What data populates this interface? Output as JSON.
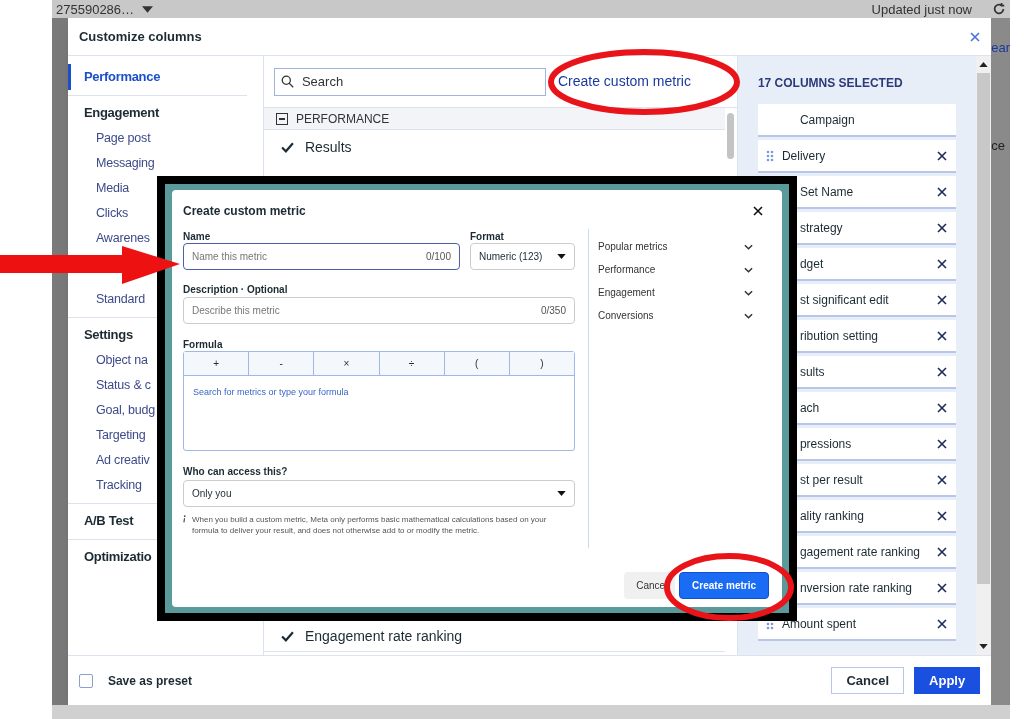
{
  "top_bar": {
    "account": "275590286…",
    "status": "Updated just now",
    "edge_fragments": [
      "ear",
      "ce"
    ]
  },
  "dialog": {
    "title": "Customize columns",
    "nav": [
      {
        "title": "Performance",
        "selected": true
      },
      {
        "title": "Engagement",
        "selected": false,
        "items": [
          {
            "label": "Page post",
            "selected": false
          },
          {
            "label": "Messaging",
            "selected": false
          },
          {
            "label": "Media",
            "selected": false
          },
          {
            "label": "Clicks",
            "selected": false
          },
          {
            "label": "Awarenes",
            "selected": false
          }
        ]
      },
      {
        "items": [
          {
            "label": "Standard",
            "selected": false
          }
        ]
      },
      {
        "title": "Settings",
        "selected": false,
        "items": [
          {
            "label": "Object na",
            "selected": false
          },
          {
            "label": "Status & c",
            "selected": false
          },
          {
            "label": "Goal, budg",
            "selected": false
          },
          {
            "label": "Targeting",
            "selected": false
          },
          {
            "label": "Ad creativ",
            "selected": false
          },
          {
            "label": "Tracking",
            "selected": false
          }
        ]
      },
      {
        "title": "A/B Test",
        "selected": false
      },
      {
        "title": "Optimizatio",
        "selected": false
      }
    ],
    "search": {
      "placeholder": "Search"
    },
    "create_link": "Create custom metric",
    "section": {
      "title": "PERFORMANCE",
      "expanded": true
    },
    "top_rows": [
      {
        "label": "Results",
        "checked": true
      }
    ],
    "bottom_rows": [
      {
        "label": "Engagement rate ranking",
        "checked": true
      }
    ],
    "selected_count": "17 COLUMNS SELECTED",
    "columns": [
      {
        "label": "Campaign",
        "handle": false,
        "removable": false
      },
      {
        "label": "Delivery",
        "handle": true,
        "removable": true
      },
      {
        "label": "Set Name",
        "handle": false,
        "removable": true
      },
      {
        "label": "strategy",
        "handle": false,
        "removable": true
      },
      {
        "label": "dget",
        "handle": false,
        "removable": true
      },
      {
        "label": "st significant edit",
        "handle": false,
        "removable": true
      },
      {
        "label": "ribution setting",
        "handle": false,
        "removable": true
      },
      {
        "label": "sults",
        "handle": false,
        "removable": true
      },
      {
        "label": "ach",
        "handle": false,
        "removable": true
      },
      {
        "label": "pressions",
        "handle": false,
        "removable": true
      },
      {
        "label": "st per result",
        "handle": false,
        "removable": true
      },
      {
        "label": "ality ranking",
        "handle": false,
        "removable": true
      },
      {
        "label": "gagement rate ranking",
        "handle": false,
        "removable": true
      },
      {
        "label": "nversion rate ranking",
        "handle": false,
        "removable": true
      },
      {
        "label": "Amount spent",
        "handle": true,
        "removable": true
      }
    ],
    "preset": {
      "label": "Save as preset",
      "checked": false
    },
    "buttons": [
      {
        "label": "Cancel",
        "kind": "secondary"
      },
      {
        "label": "Apply",
        "kind": "primary"
      }
    ]
  },
  "modal": {
    "title": "Create custom metric",
    "name": {
      "label": "Name",
      "placeholder": "Name this metric",
      "counter": "0/100"
    },
    "format": {
      "label": "Format",
      "value": "Numeric (123)"
    },
    "description": {
      "label": "Description · Optional",
      "placeholder": "Describe this metric",
      "counter": "0/350"
    },
    "formula": {
      "label": "Formula",
      "operators": [
        "+",
        "-",
        "×",
        "÷",
        "(",
        ")"
      ],
      "placeholder": "Search for metrics or type your formula"
    },
    "access": {
      "label": "Who can access this?",
      "value": "Only you"
    },
    "note": "When you build a custom metric, Meta only performs basic mathematical calculations based on your formula to deliver your result, and does not otherwise add to or modify the metric.",
    "categories": [
      {
        "label": "Popular metrics",
        "expanded": false
      },
      {
        "label": "Performance",
        "expanded": false
      },
      {
        "label": "Engagement",
        "expanded": false
      },
      {
        "label": "Conversions",
        "expanded": false
      }
    ],
    "buttons": [
      {
        "label": "Cance",
        "kind": "secondary"
      },
      {
        "label": "Create metric",
        "kind": "primary"
      }
    ]
  }
}
